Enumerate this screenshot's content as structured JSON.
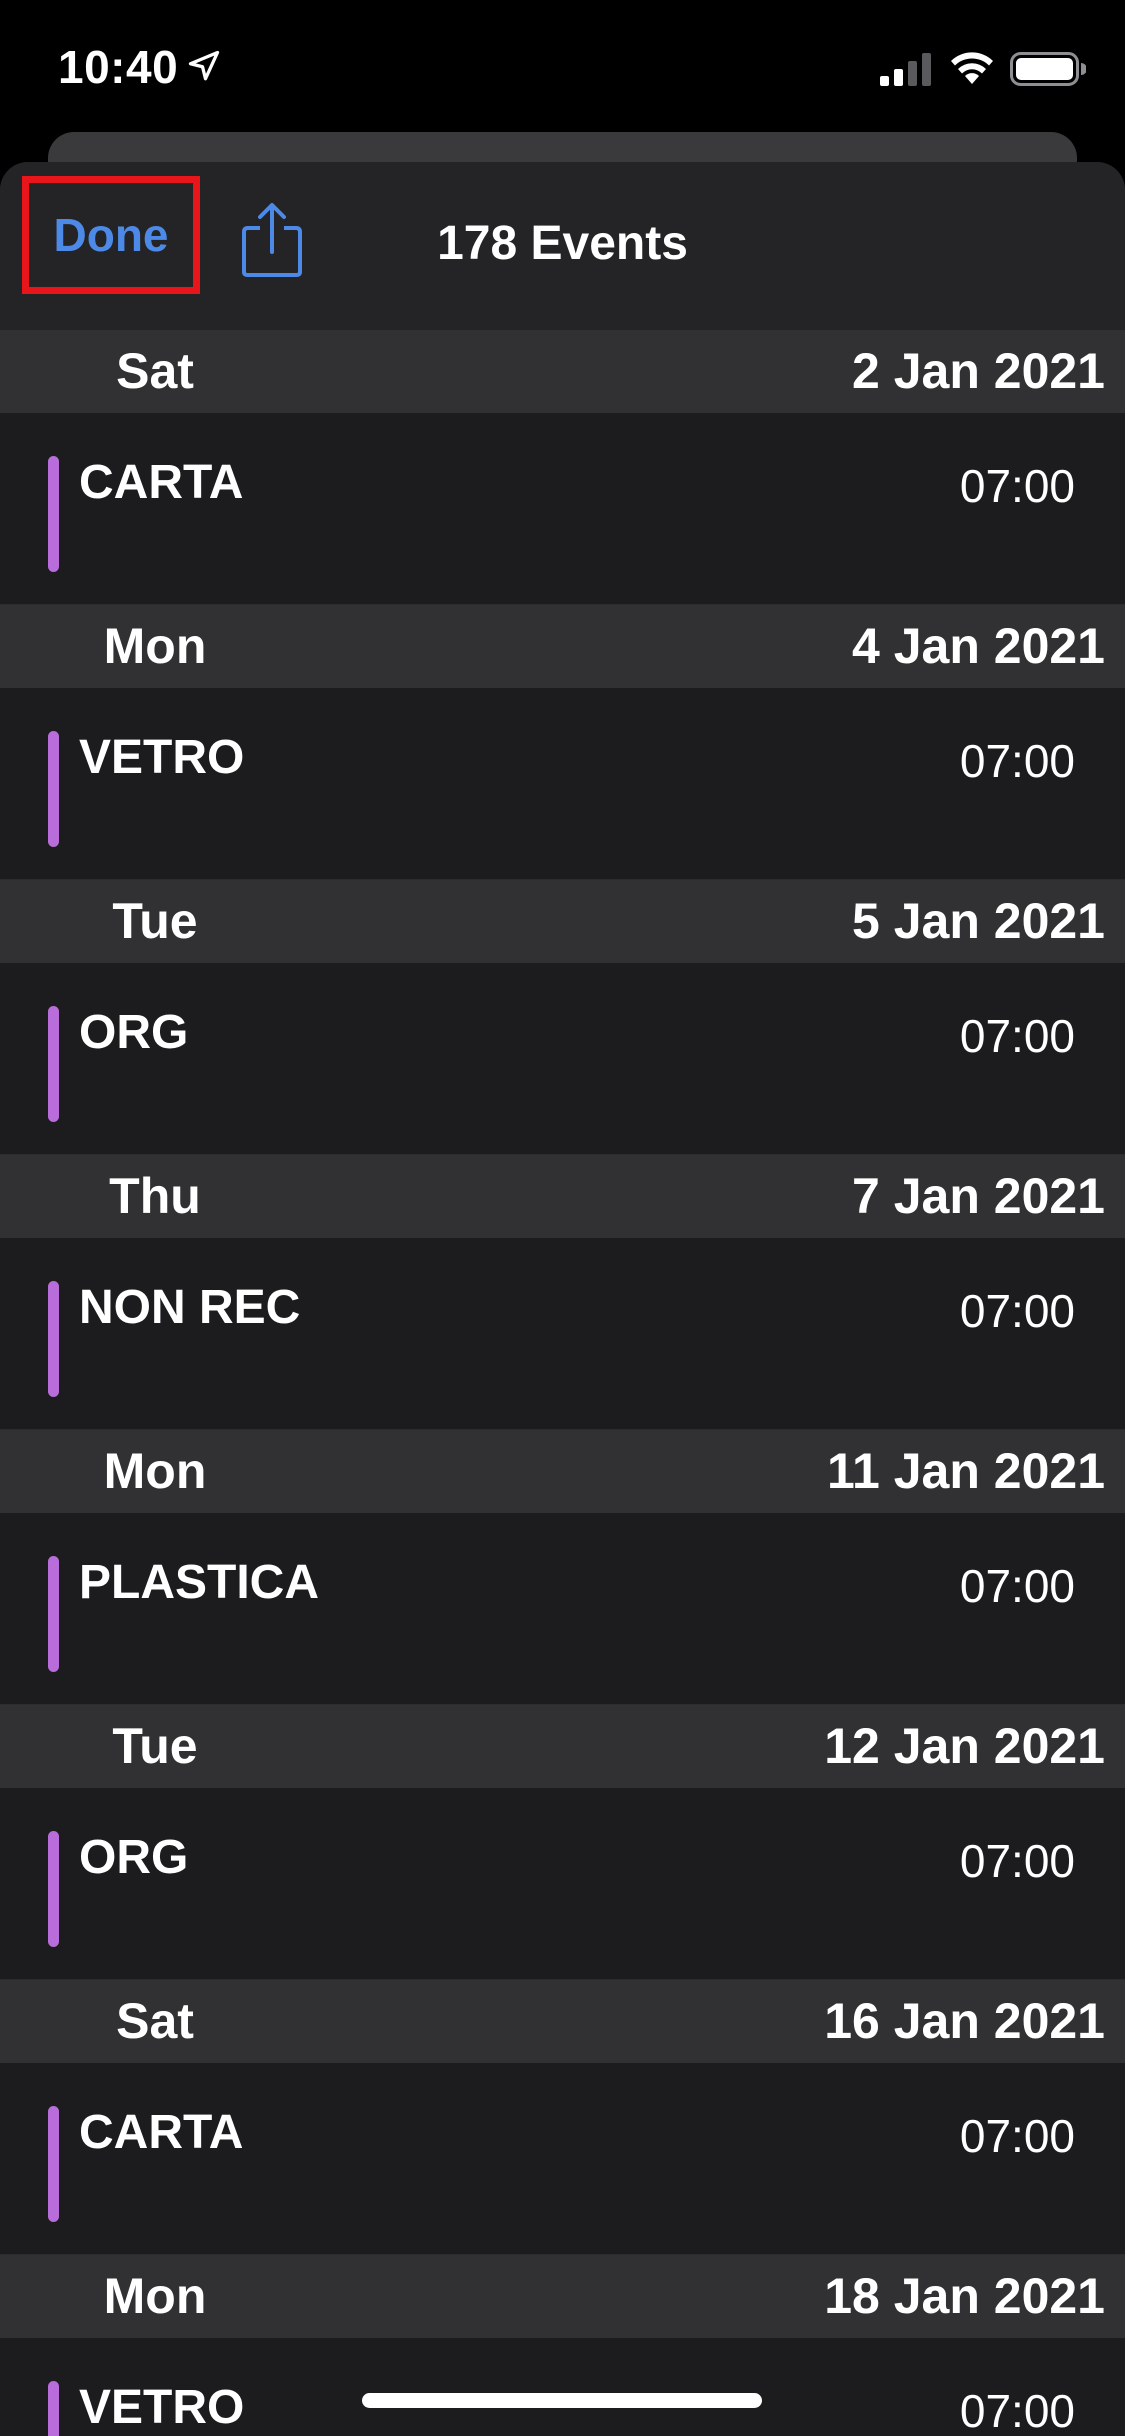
{
  "status_bar": {
    "time": "10:40",
    "icons": [
      "location-arrow-icon",
      "cellular-signal-icon",
      "wifi-icon",
      "battery-icon"
    ]
  },
  "nav": {
    "done_label": "Done",
    "share_icon": "share-icon",
    "title": "178 Events"
  },
  "colors": {
    "accent": "#4d8ae8",
    "event_bar": "#b86ddb",
    "highlight_box": "#e8151b",
    "background": "#1c1c1e",
    "header_background": "#313133"
  },
  "days": [
    {
      "day": "Sat",
      "date": "2 Jan 2021",
      "events": [
        {
          "title": "CARTA",
          "time": "07:00"
        }
      ]
    },
    {
      "day": "Mon",
      "date": "4 Jan 2021",
      "events": [
        {
          "title": "VETRO",
          "time": "07:00"
        }
      ]
    },
    {
      "day": "Tue",
      "date": "5 Jan 2021",
      "events": [
        {
          "title": "ORG",
          "time": "07:00"
        }
      ]
    },
    {
      "day": "Thu",
      "date": "7 Jan 2021",
      "events": [
        {
          "title": "NON REC",
          "time": "07:00"
        }
      ]
    },
    {
      "day": "Mon",
      "date": "11 Jan 2021",
      "events": [
        {
          "title": "PLASTICA",
          "time": "07:00"
        }
      ]
    },
    {
      "day": "Tue",
      "date": "12 Jan 2021",
      "events": [
        {
          "title": "ORG",
          "time": "07:00"
        }
      ]
    },
    {
      "day": "Sat",
      "date": "16 Jan 2021",
      "events": [
        {
          "title": "CARTA",
          "time": "07:00"
        }
      ]
    },
    {
      "day": "Mon",
      "date": "18 Jan 2021",
      "events": [
        {
          "title": "VETRO",
          "time": "07:00"
        }
      ]
    }
  ]
}
